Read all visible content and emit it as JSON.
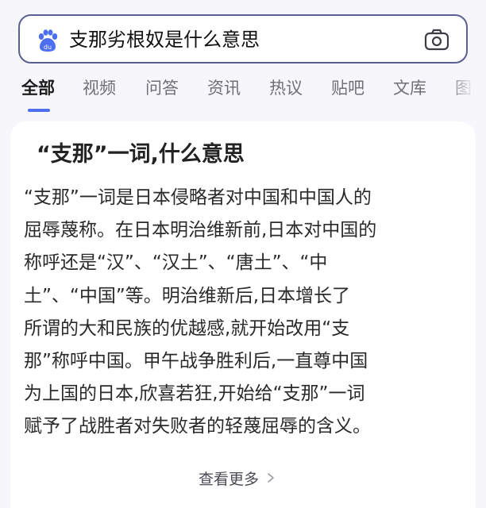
{
  "search": {
    "query": "支那劣根奴是什么意思"
  },
  "tabs": [
    {
      "label": "全部",
      "active": true
    },
    {
      "label": "视频"
    },
    {
      "label": "问答"
    },
    {
      "label": "资讯"
    },
    {
      "label": "热议"
    },
    {
      "label": "贴吧"
    },
    {
      "label": "文库"
    },
    {
      "label": "图片"
    }
  ],
  "result": {
    "title": "“支那”一词,什么意思",
    "lines": [
      "“支那”一词是日本侵略者对中国和中国人的",
      "屈辱蔑称。在日本明治维新前,日本对中国的",
      "称呼还是“汉”、“汉土”、“唐土”、“中",
      "土”、“中国”等。明治维新后,日本增长了",
      "所谓的大和民族的优越感,就开始改用“支",
      "那”称呼中国。甲午战争胜利后,一直尊中国",
      "为上国的日本,欣喜若狂,开始给“支那”一词",
      "赋予了战胜者对失败者的轻蔑屈辱的含义。"
    ],
    "see_more_label": "查看更多"
  },
  "colors": {
    "search_border": "#5b5f92",
    "brand_blue": "#4e6ef2",
    "page_bg": "#f7f7fb",
    "card_bg": "#ffffff",
    "tab_inactive": "#6f6f78"
  },
  "icons": {
    "logo": "baidu-paw-logo",
    "camera": "camera-icon",
    "chevron": "chevron-right-icon"
  }
}
